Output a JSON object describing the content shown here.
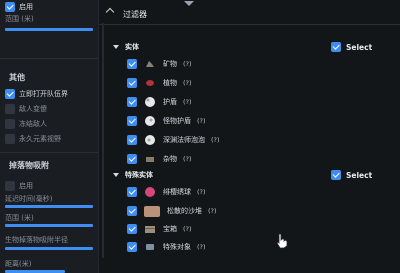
{
  "left_panel": {
    "top_toggle": {
      "label": "启用",
      "checked": true
    },
    "range_label": "范围 (米)",
    "other": {
      "title": "其他",
      "items": [
        {
          "label": "立即打开队伍界",
          "checked": true
        },
        {
          "label": "敌人变傻",
          "checked": false
        },
        {
          "label": "冻结敌人",
          "checked": false
        },
        {
          "label": "永久元素视野",
          "checked": false
        }
      ]
    },
    "drop_pull": {
      "title": "掉落物吸附",
      "enable_label": "启用",
      "enable_checked": false,
      "delay_label": "延迟时间(毫秒)",
      "range_label": "范围 (米)",
      "radius_label": "生物掉落物吸附半径",
      "distance_label": "距离(米)"
    }
  },
  "filter": {
    "title": "过滤器",
    "select_label": "Select",
    "categories": [
      {
        "name": "实体",
        "select_checked": true,
        "items": [
          {
            "label": "矿物",
            "count": "(?)",
            "icon": "ore-icon",
            "checked": true
          },
          {
            "label": "植物",
            "count": "(?)",
            "icon": "plant-icon",
            "checked": true
          },
          {
            "label": "护盾",
            "count": "(?)",
            "icon": "shield-bubble-icon",
            "checked": true
          },
          {
            "label": "怪物护盾",
            "count": "(?)",
            "icon": "monster-shield-icon",
            "checked": true
          },
          {
            "label": "深渊法师泡泡",
            "count": "(?)",
            "icon": "abyss-bubble-icon",
            "checked": true
          },
          {
            "label": "杂物",
            "count": "(?)",
            "icon": "misc-icon",
            "checked": true
          }
        ]
      },
      {
        "name": "特殊实体",
        "select_checked": true,
        "items": [
          {
            "label": "绯樱绣球",
            "count": "(?)",
            "icon": "sakura-bloom-icon",
            "checked": true
          },
          {
            "label": "松散的沙堆",
            "count": "(?)",
            "icon": "sand-pile-icon",
            "checked": true
          },
          {
            "label": "宝箱",
            "count": "(?)",
            "icon": "chest-icon",
            "checked": true
          },
          {
            "label": "特殊对象",
            "count": "(?)",
            "icon": "special-object-icon",
            "checked": true
          }
        ]
      }
    ]
  },
  "colors": {
    "accent": "#3d8ef0",
    "panel": "#1a1d22",
    "popup": "#131619"
  }
}
